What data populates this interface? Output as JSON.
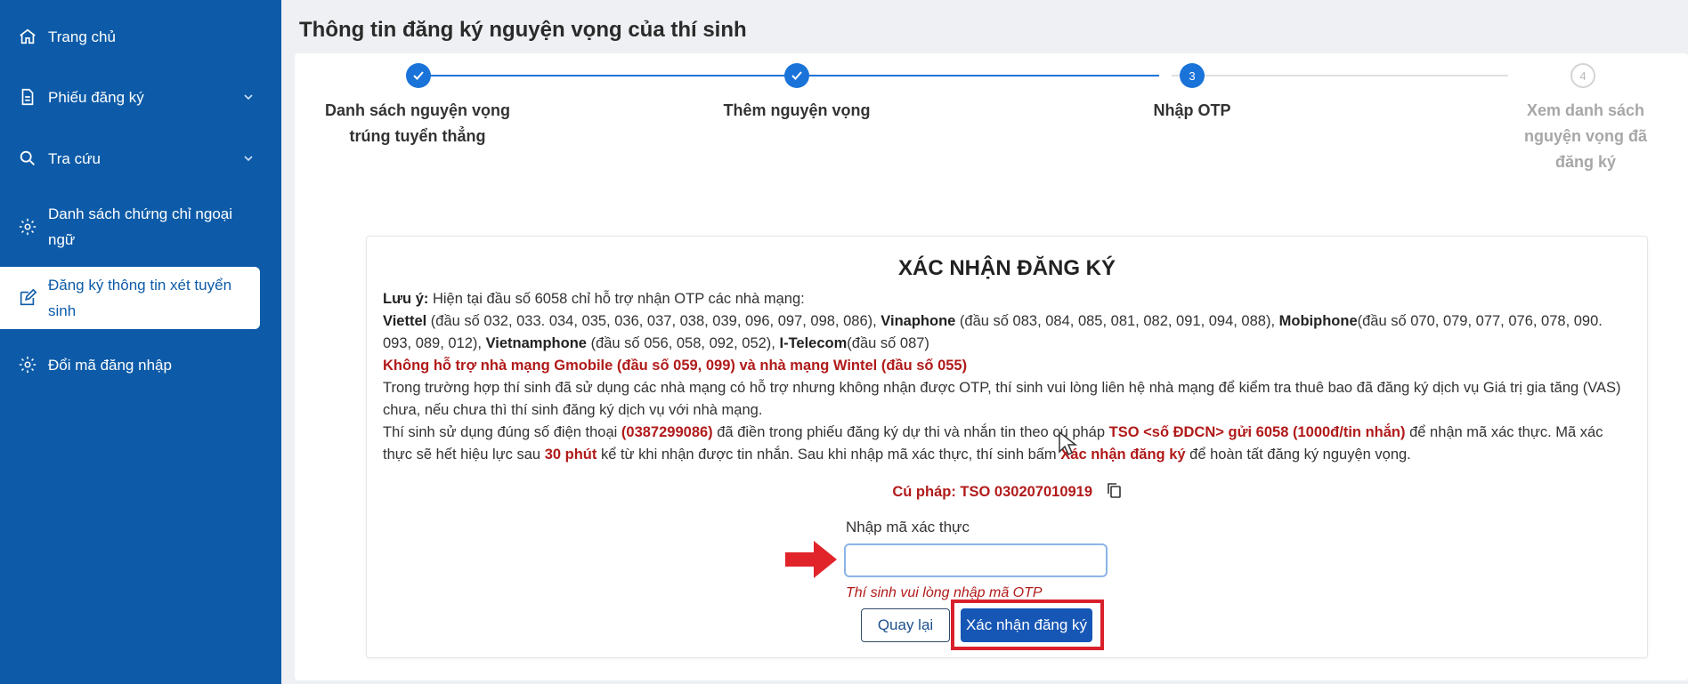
{
  "sidebar": {
    "items": [
      {
        "label": "Trang chủ",
        "icon": "home-icon"
      },
      {
        "label": "Phiếu đăng ký",
        "icon": "document-icon",
        "expandable": true
      },
      {
        "label": "Tra cứu",
        "icon": "search-icon",
        "expandable": true
      },
      {
        "label": "Danh sách chứng chỉ ngoại ngữ",
        "icon": "gear-icon"
      },
      {
        "label": "Đăng ký thông tin xét tuyển sinh",
        "icon": "edit-icon",
        "active": true
      },
      {
        "label": "Đổi mã đăng nhập",
        "icon": "gear-icon"
      }
    ]
  },
  "page_title": "Thông tin đăng ký nguyện vọng của thí sinh",
  "stepper": {
    "steps": [
      {
        "number": "1",
        "label": "Danh sách nguyện vọng trúng tuyển thẳng",
        "state": "done"
      },
      {
        "number": "2",
        "label": "Thêm nguyện vọng",
        "state": "done"
      },
      {
        "number": "3",
        "label": "Nhập OTP",
        "state": "current"
      },
      {
        "number": "4",
        "label": "Xem danh sách nguyện vọng đã đăng ký",
        "state": "todo"
      }
    ]
  },
  "confirm": {
    "title": "XÁC NHẬN ĐĂNG KÝ",
    "note_label": "Lưu ý:",
    "note_text": " Hiện tại đầu số 6058 chỉ hỗ trợ nhận OTP các nhà mạng:",
    "carriers": {
      "viettel": "Viettel",
      "viettel_prefix": " (đầu số 032, 033. 034, 035, 036, 037, 038, 039, 096, 097, 098, 086), ",
      "vinaphone": "Vinaphone",
      "vinaphone_prefix": " (đầu số 083, 084, 085, 081, 082, 091, 094, 088), ",
      "mobiphone": "Mobiphone",
      "mobiphone_prefix": "(đầu số 070, 079, 077, 076, 078, 090. 093, 089, 012), ",
      "vietnamphone": "Vietnamphone",
      "vietnamphone_prefix": " (đầu số 056, 058, 092, 052), ",
      "itelecom": "I-Telecom",
      "itelecom_prefix": "(đầu số 087)"
    },
    "unsupported": "Không hỗ trợ nhà mạng Gmobile (đầu số 059, 099) và nhà mạng Wintel (đầu số 055)",
    "vas_note": "Trong trường hợp thí sinh đã sử dụng các nhà mạng có hỗ trợ nhưng không nhận được OTP, thí sinh vui lòng liên hệ nhà mạng để kiểm tra thuê bao đã đăng ký dịch vụ Giá trị gia tăng (VAS) chưa, nếu chưa thì thí sinh đăng ký dịch vụ với nhà mạng.",
    "instr_1": "Thí sinh sử dụng đúng số điện thoại ",
    "phone": "(0387299086)",
    "instr_2": " đã điền trong phiếu đăng ký dự thi và nhắn tin theo cú pháp ",
    "syntax_hint": "TSO <số ĐDCN> gửi 6058 (1000đ/tin nhắn)",
    "instr_3": " để nhận mã xác thực. Mã xác thực sẽ hết hiệu lực sau ",
    "validity": "30 phút",
    "instr_4": " kể từ khi nhận được tin nhắn. Sau khi nhập mã xác thực, thí sinh bấm ",
    "confirm_ref": "Xác nhận đăng ký",
    "instr_5": " để hoàn tất đăng ký nguyện vọng.",
    "syntax": "Cú pháp: TSO 030207010919",
    "otp_label": "Nhập mã xác thực",
    "otp_value": "",
    "otp_error": "Thí sinh vui lòng nhập mã OTP",
    "back_button": "Quay lại",
    "confirm_button": "Xác nhận đăng ký"
  },
  "colors": {
    "sidebar": "#0d5ba8",
    "primary": "#1656b5",
    "accent_red": "#b11a1a",
    "highlight": "#d8212b"
  }
}
